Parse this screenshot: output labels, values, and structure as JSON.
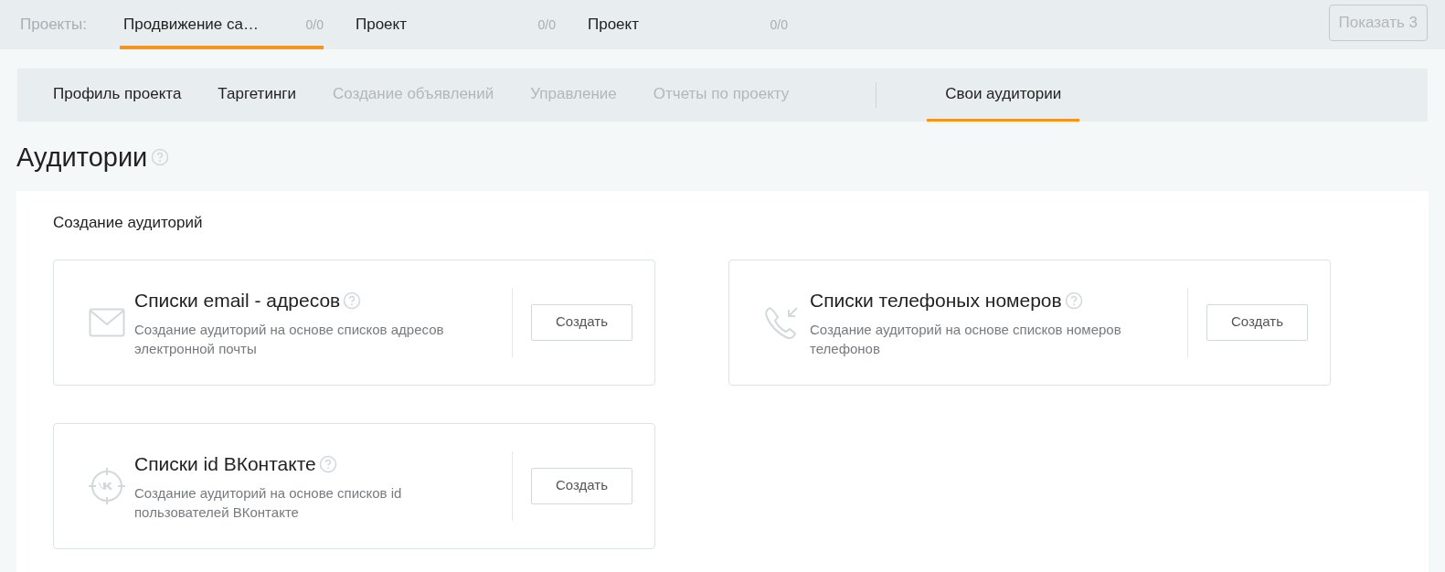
{
  "projects_bar": {
    "label": "Проекты:",
    "tabs": [
      {
        "name": "Продвижение са…",
        "count": "0/0",
        "selected": true
      },
      {
        "name": "Проект",
        "count": "0/0",
        "selected": false
      },
      {
        "name": "Проект",
        "count": "0/0",
        "selected": false
      }
    ],
    "show_button": {
      "label": "Показать 3",
      "disabled": true
    }
  },
  "section_nav": {
    "items": [
      {
        "label": "Профиль проекта",
        "disabled": false,
        "selected": false
      },
      {
        "label": "Таргетинги",
        "disabled": false,
        "selected": false
      },
      {
        "label": "Создание объявлений",
        "disabled": true,
        "selected": false
      },
      {
        "label": "Управление",
        "disabled": true,
        "selected": false
      },
      {
        "label": "Отчеты по проекту",
        "disabled": true,
        "selected": false
      }
    ],
    "extra_items": [
      {
        "label": "Свои аудитории",
        "disabled": false,
        "selected": true
      }
    ]
  },
  "page_title": "Аудитории",
  "panel": {
    "title": "Создание аудиторий",
    "cards": [
      {
        "kind": "email",
        "title": "Списки email - адресов",
        "description": "Создание аудиторий на основе списков адресов электронной почты",
        "button": "Создать"
      },
      {
        "kind": "phone",
        "title": "Списки телефоных номеров",
        "description": "Создание аудиторий на основе списков номеров телефонов",
        "button": "Создать"
      },
      {
        "kind": "vk",
        "title": "Списки id ВКонтакте",
        "description": "Создание аудиторий на основе списков id пользователей ВКонтакте",
        "button": "Создать"
      }
    ]
  }
}
